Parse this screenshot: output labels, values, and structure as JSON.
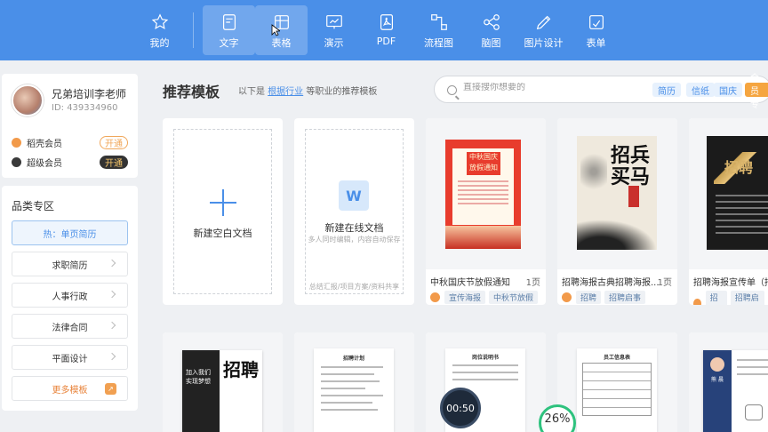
{
  "nav": {
    "items": [
      {
        "label": "我的",
        "icon": "star-icon"
      },
      {
        "label": "文字",
        "icon": "document-icon"
      },
      {
        "label": "表格",
        "icon": "table-icon"
      },
      {
        "label": "演示",
        "icon": "presentation-icon"
      },
      {
        "label": "PDF",
        "icon": "pdf-icon"
      },
      {
        "label": "流程图",
        "icon": "flowchart-icon"
      },
      {
        "label": "脑图",
        "icon": "mindmap-icon"
      },
      {
        "label": "图片设计",
        "icon": "image-design-icon"
      },
      {
        "label": "表单",
        "icon": "form-icon"
      }
    ],
    "active_index": 1
  },
  "user": {
    "name": "兄弟培训李老师",
    "id": "ID: 439334960",
    "memberships": [
      {
        "label": "稻壳会员",
        "button": "开通",
        "color": "#f29a4a"
      },
      {
        "label": "超级会员",
        "button": "开通",
        "color": "#3a3a3a"
      }
    ]
  },
  "categories": {
    "title": "品类专区",
    "items": [
      "热：单页简历",
      "求职简历",
      "人事行政",
      "法律合同",
      "平面设计",
      "更多模板"
    ]
  },
  "main": {
    "title": "推荐模板",
    "subtitle_prefix": "以下是",
    "subtitle_link": "根据行业",
    "subtitle_suffix": "等职业的推荐模板",
    "search_placeholder": "直接搜你想要的",
    "tags": [
      "简历",
      "信纸",
      "国庆",
      "会员专"
    ]
  },
  "cards": {
    "blank": {
      "label": "新建空白文档"
    },
    "online": {
      "icon_letter": "W",
      "label": "新建在线文档",
      "desc": "多人同时编辑，内容自动保存",
      "foot": "总结汇报/项目方案/资料共享"
    },
    "templates": [
      {
        "name": "中秋国庆节放假通知",
        "pages": "1页",
        "tags": [
          "宣传海报",
          "中秋节放假"
        ],
        "poster_title": "中秋国庆放假通知"
      },
      {
        "name": "招聘海报古典招聘海报...",
        "pages": "1页",
        "tags": [
          "招聘",
          "招聘启事"
        ],
        "poster_title": "招兵买马"
      },
      {
        "name": "招聘海报宣传单（招聘",
        "pages": "",
        "tags": [
          "招聘",
          "招聘启事"
        ],
        "poster_title": "招聘"
      }
    ],
    "bottom": [
      {
        "poster_title": "招聘",
        "side_text": "加入我们 实现梦想"
      },
      {
        "doc_title": "招聘计划"
      },
      {
        "doc_title": "岗位说明书"
      },
      {
        "doc_title": "员工信息表"
      },
      {
        "resume_name": "熊 晨"
      }
    ]
  },
  "overlays": {
    "timer": "00:50",
    "progress": "26%"
  }
}
